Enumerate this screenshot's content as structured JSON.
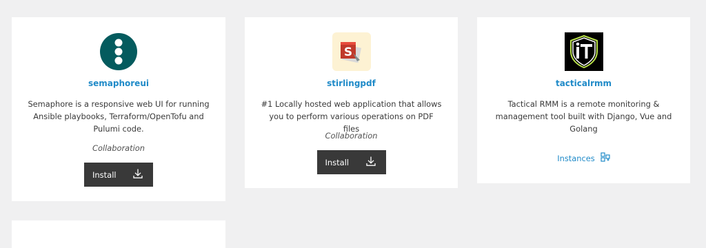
{
  "cards": [
    {
      "name": "semaphoreui",
      "description": "Semaphore is a responsive web UI for running Ansible playbooks, Terraform/OpenTofu and Pulumi code.",
      "category": "Collaboration",
      "action_label": "Install",
      "icon": "semaphore-logo",
      "icon_color": "#045b5e"
    },
    {
      "name": "stirlingpdf",
      "description": "#1 Locally hosted web application that allows you to perform various operations on PDF files",
      "category": "Collaboration",
      "action_label": "Install",
      "icon": "stirling-pdf-logo",
      "icon_color": "#c0392b"
    },
    {
      "name": "tacticalrmm",
      "description": "Tactical RMM is a remote monitoring & management tool built with Django, Vue and Golang",
      "action_label": "Instances",
      "icon": "tactical-rmm-logo",
      "icon_color": "#000000"
    }
  ],
  "colors": {
    "background": "#f0f0f1",
    "link": "#1f8ac8",
    "button": "#393939"
  }
}
